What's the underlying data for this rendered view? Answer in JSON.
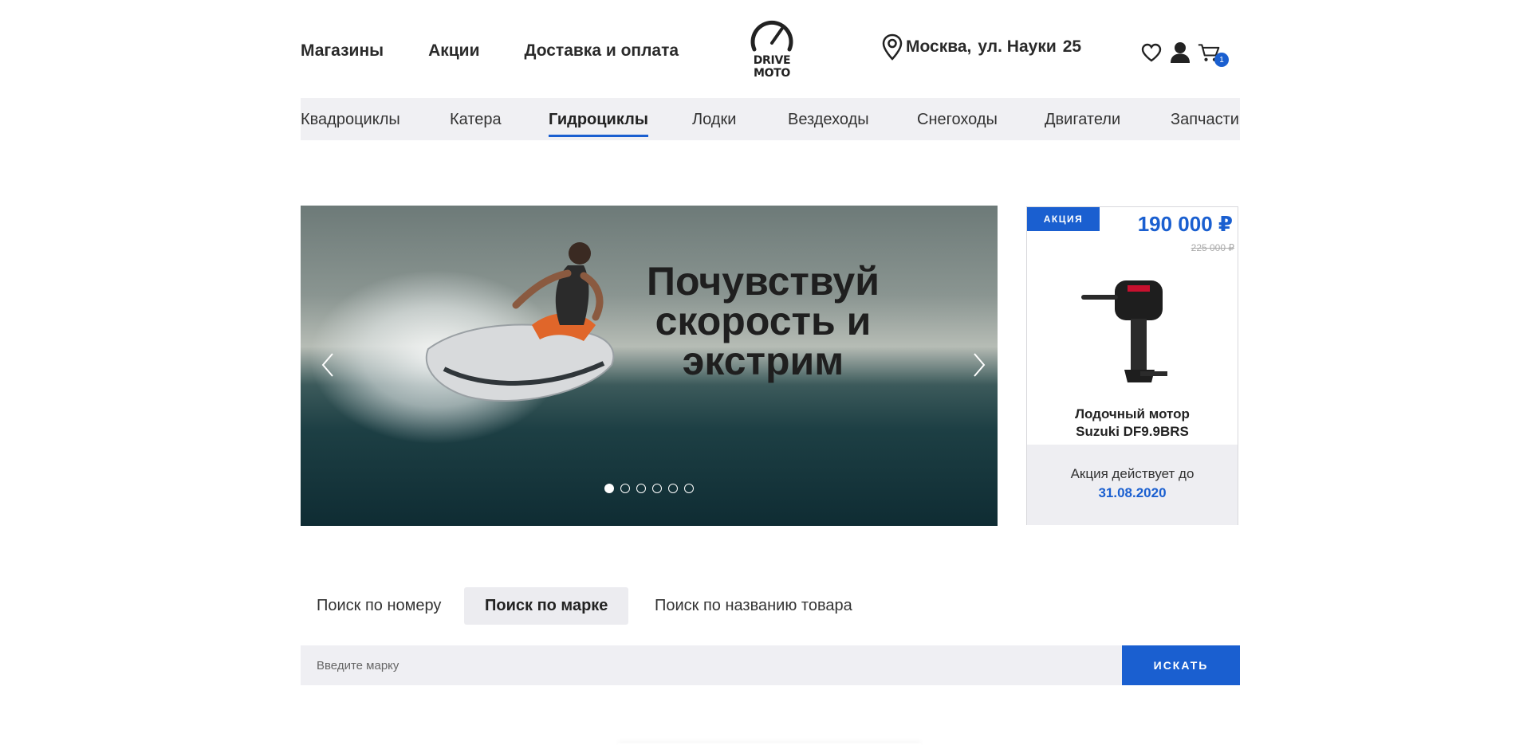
{
  "header": {
    "nav": [
      "Магазины",
      "Акции",
      "Доставка и оплата"
    ],
    "logo_text": "DRIVE MOTO",
    "address": {
      "city": "Москва,",
      "street": "ул. Науки",
      "number": "25"
    },
    "icons": [
      "heart-icon",
      "user-icon",
      "cart-icon"
    ],
    "cart_count": "1"
  },
  "categories": {
    "items": [
      "Квадроциклы",
      "Катера",
      "Гидроциклы",
      "Лодки",
      "Вездеходы",
      "Снегоходы",
      "Двигатели",
      "Запчасти"
    ],
    "active_index": 2
  },
  "banner": {
    "title_line1": "Почувствуй",
    "title_line2": "скорость и",
    "title_line3": "экстрим",
    "slides": 6,
    "active_slide": 0
  },
  "promo": {
    "badge": "АКЦИЯ",
    "price": "190 000 ₽",
    "old_price": "225 000 ₽",
    "name_line1": "Лодочный мотор",
    "name_line2": "Suzuki DF9.9BRS",
    "valid_text": "Акция действует до",
    "valid_date": "31.08.2020"
  },
  "search": {
    "tabs": [
      "Поиск по  номеру",
      "Поиск по марке",
      "Поиск по названию товара"
    ],
    "active_tab": 1,
    "placeholder": "Введите марку",
    "button": "ИСКАТЬ"
  },
  "colors": {
    "accent": "#1a5fd0",
    "bar_bg": "#f0f0f3"
  }
}
